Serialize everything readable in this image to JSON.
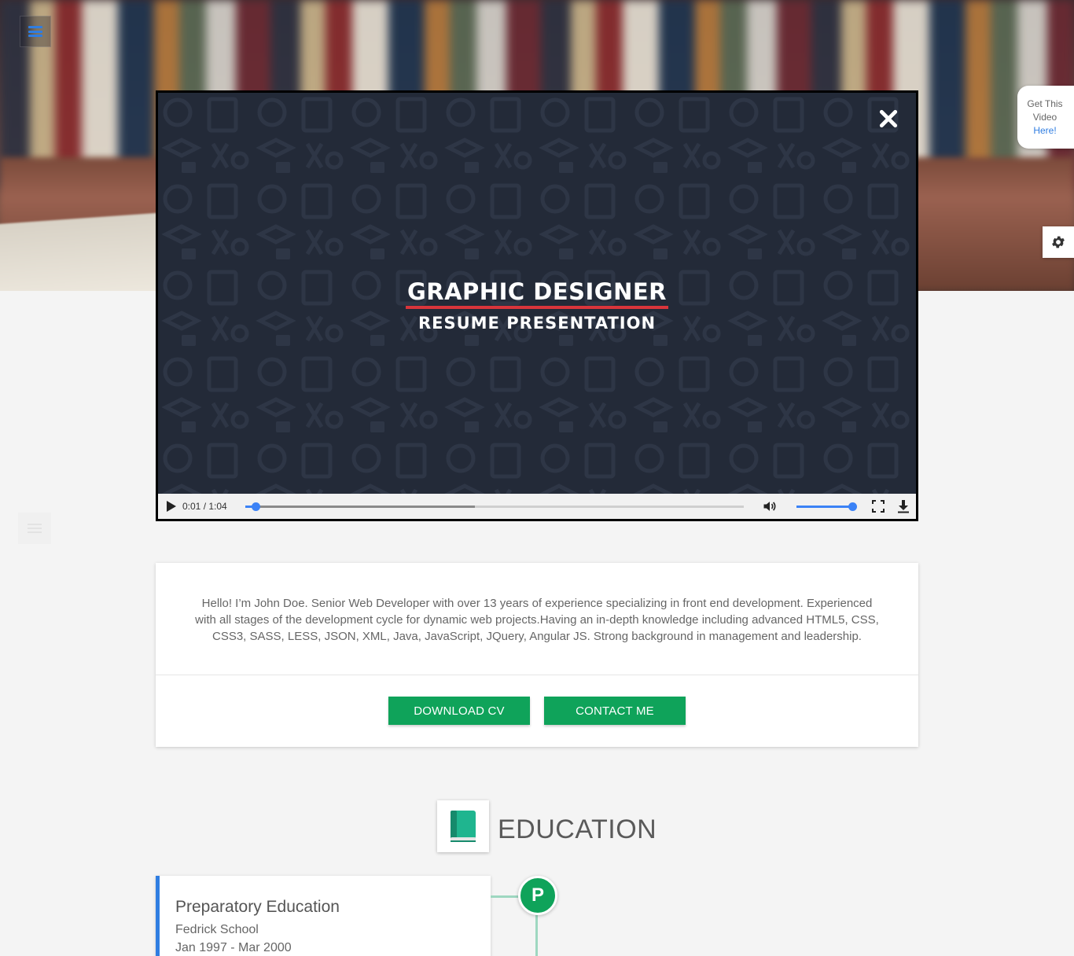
{
  "hero": {
    "menu_icon": "hamburger-icon"
  },
  "side_widgets": {
    "get_video_line1": "Get This",
    "get_video_line2": "Video",
    "get_video_link": "Here!",
    "settings_icon": "gear-icon"
  },
  "video": {
    "title_line1": "GRAPHIC DESIGNER",
    "title_line2": "RESUME PRESENTATION",
    "close_icon": "close-icon",
    "time_current": "0:01",
    "time_separator": " / ",
    "time_total": "1:04",
    "progress_played": 0.02,
    "progress_buffered": 0.46,
    "volume": 1.0,
    "accent": "#3b82f6",
    "underline_color": "#d9353b"
  },
  "about": {
    "text": "Hello! I’m John Doe. Senior Web Developer with over 13 years of experience specializing in front end development. Experienced with all stages of the development cycle for dynamic web projects.Having an in-depth knowledge including advanced HTML5, CSS, CSS3, SASS, LESS, JSON, XML, Java, JavaScript, JQuery, Angular JS. Strong background in management and leadership.",
    "download_label": "DOWNLOAD CV",
    "contact_label": "CONTACT ME",
    "button_color": "#0fa35a"
  },
  "education": {
    "heading": "EDUCATION",
    "icon": "book-icon",
    "items": [
      {
        "degree": "Preparatory Education",
        "school": "Fedrick School",
        "dates": "Jan 1997 - Mar 2000",
        "marker": "P"
      }
    ],
    "accent": "#2f7de1"
  }
}
